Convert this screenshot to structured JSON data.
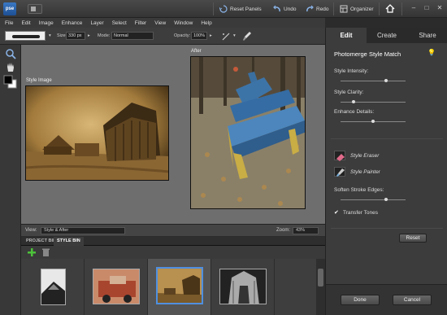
{
  "app": {
    "logo_text": "pse"
  },
  "titlebar": {
    "reset_panels": "Reset Panels",
    "undo": "Undo",
    "redo": "Redo",
    "organizer": "Organizer"
  },
  "menu": [
    "File",
    "Edit",
    "Image",
    "Enhance",
    "Layer",
    "Select",
    "Filter",
    "View",
    "Window",
    "Help"
  ],
  "options": {
    "size_label": "Size:",
    "size_value": "330 px",
    "mode_label": "Mode:",
    "mode_value": "Normal",
    "opacity_label": "Opacity:",
    "opacity_value": "100%"
  },
  "canvas": {
    "style_image_label": "Style Image",
    "after_label": "After"
  },
  "viewbar": {
    "view_label": "View:",
    "view_value": "Style & After",
    "zoom_label": "Zoom:",
    "zoom_value": "43%"
  },
  "bin": {
    "tab_project": "PROJECT BIN",
    "tab_style": "STYLE BIN",
    "selected_index": 2
  },
  "panel": {
    "tabs": [
      "Edit",
      "Create",
      "Share"
    ],
    "active_tab": "Edit",
    "title": "Photomerge Style Match",
    "style_intensity": "Style Intensity:",
    "style_clarity": "Style Clarity:",
    "enhance_details": "Enhance Details:",
    "style_eraser": "Style Eraser",
    "style_painter": "Style Painter",
    "soften_stroke_edges": "Soften Stroke Edges:",
    "transfer_tones": "Transfer Tones",
    "transfer_tones_checked": true,
    "reset": "Reset",
    "done": "Done",
    "cancel": "Cancel",
    "sliders": {
      "style_intensity": 0.7,
      "style_clarity": 0.2,
      "enhance_details": 0.5,
      "soften_stroke_edges": 0.7
    }
  },
  "colors": {
    "accent_blue": "#3a78c4",
    "selection_border": "#4f8fe0"
  }
}
